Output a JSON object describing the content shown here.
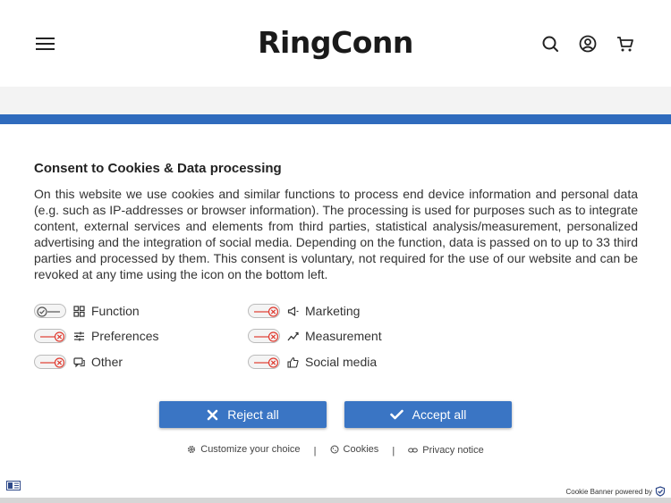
{
  "header": {
    "logo": "RingConn",
    "icons": [
      "menu-icon",
      "search-icon",
      "account-icon",
      "cart-icon"
    ]
  },
  "consent": {
    "title": "Consent to Cookies & Data processing",
    "description": "On this website we use cookies and similar functions to process end device information and personal data (e.g. such as IP-addresses or browser information). The processing is used for purposes such as to integrate content, external services and elements from third parties, statistical analysis/measurement, personalized advertising and the integration of social media. Depending on the function, data is passed on to up to 33 third parties and processed by them. This consent is voluntary, not required for the use of our website and can be revoked at any time using the icon on the bottom left.",
    "options": {
      "function": {
        "label": "Function",
        "icon": "puzzle-icon",
        "enabled": true
      },
      "marketing": {
        "label": "Marketing",
        "icon": "megaphone-icon",
        "enabled": false
      },
      "preferences": {
        "label": "Preferences",
        "icon": "sliders-icon",
        "enabled": false
      },
      "measurement": {
        "label": "Measurement",
        "icon": "trend-icon",
        "enabled": false
      },
      "other": {
        "label": "Other",
        "icon": "chat-icon",
        "enabled": false
      },
      "social_media": {
        "label": "Social media",
        "icon": "thumbs-up-icon",
        "enabled": false
      }
    },
    "buttons": {
      "reject": "Reject all",
      "accept": "Accept all"
    },
    "links": {
      "customize": "Customize your choice",
      "cookies": "Cookies",
      "privacy": "Privacy notice",
      "separator": "|"
    },
    "powered_by": "Cookie Banner powered by"
  },
  "colors": {
    "accent": "#3a75c4",
    "bar": "#2f6bbd",
    "toggle_off": "#e03c31"
  }
}
